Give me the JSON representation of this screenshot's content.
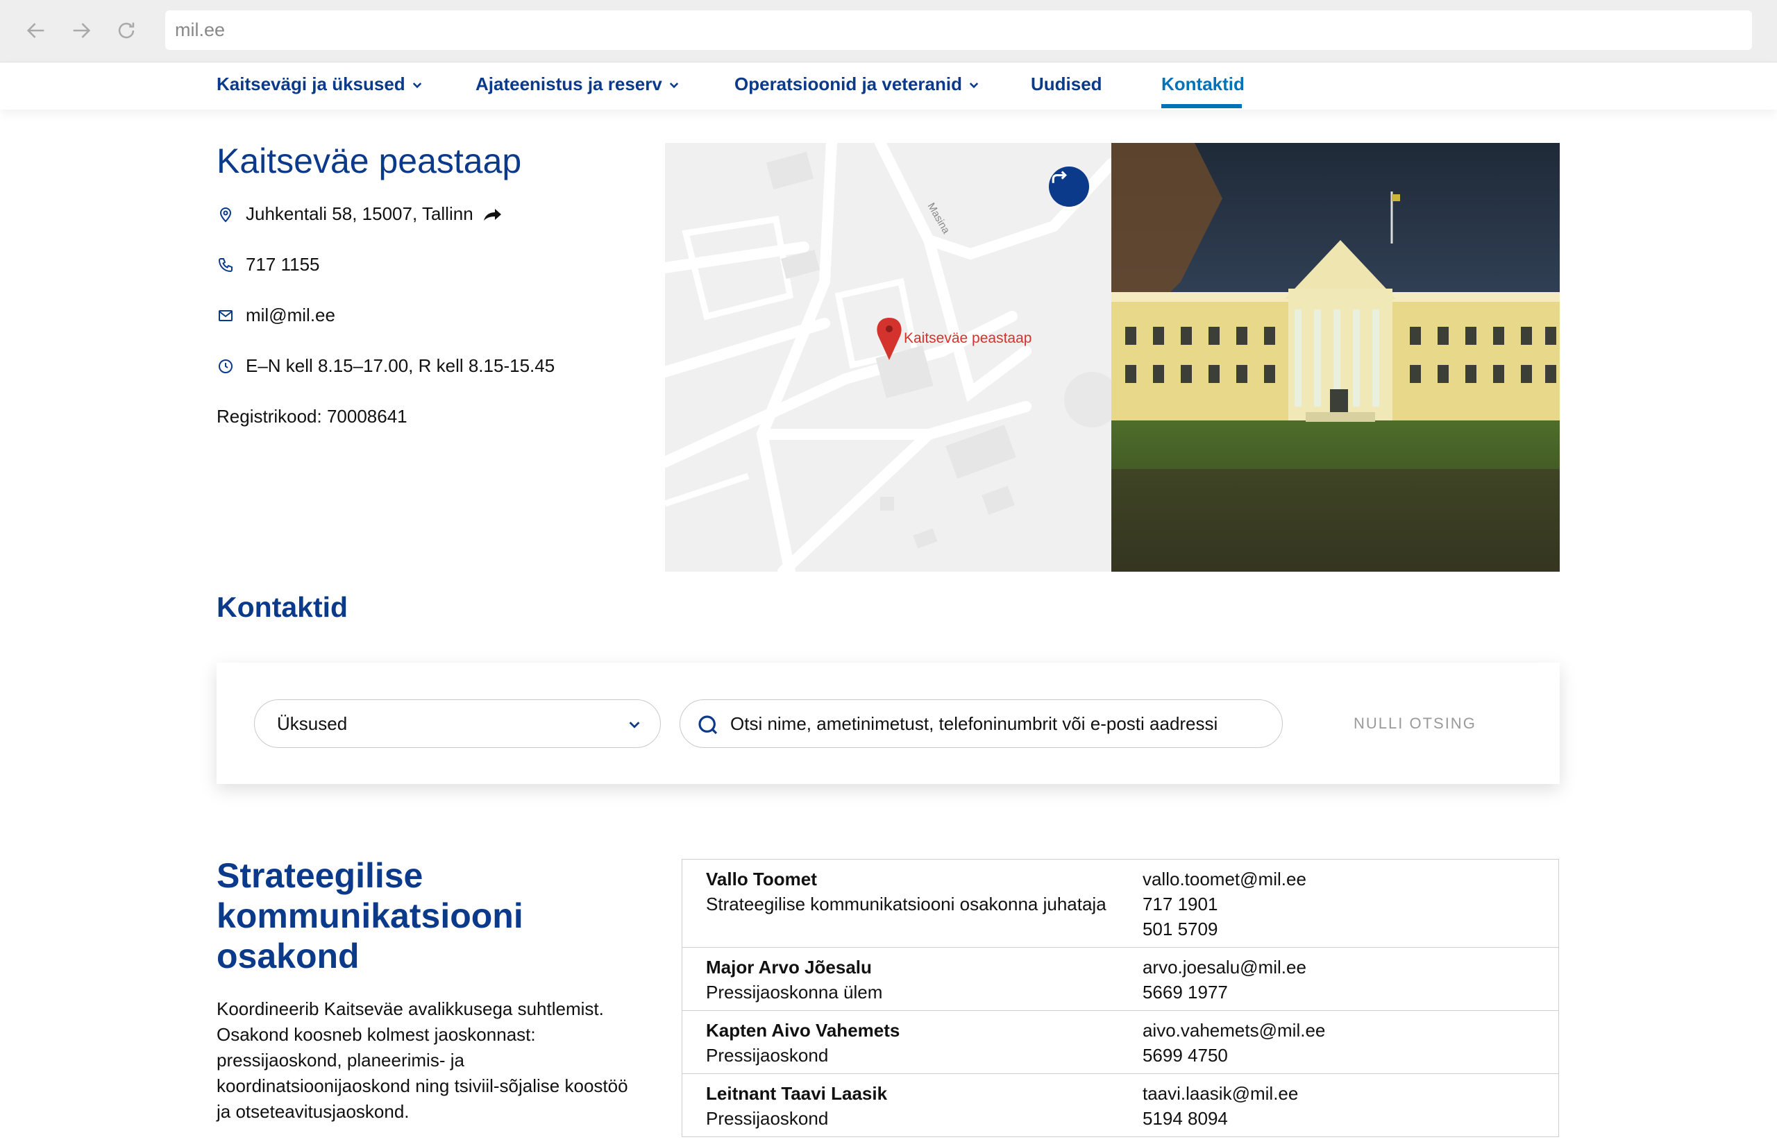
{
  "browser": {
    "url": "mil.ee"
  },
  "nav": {
    "items": [
      {
        "label": "Kaitsevägi ja üksused",
        "dropdown": true
      },
      {
        "label": "Ajateenistus ja reserv",
        "dropdown": true
      },
      {
        "label": "Operatsioonid ja veteranid",
        "dropdown": true
      },
      {
        "label": "Uudised",
        "dropdown": false
      },
      {
        "label": "Kontaktid",
        "dropdown": false,
        "active": true
      }
    ]
  },
  "hq": {
    "title": "Kaitseväe peastaap",
    "address": "Juhkentali 58, 15007, Tallinn",
    "phone": "717 1155",
    "email": "mil@mil.ee",
    "hours": "E–N kell 8.15–17.00, R kell 8.15-15.45",
    "regcode": "Registrikood: 70008641"
  },
  "map": {
    "marker_label": "Kaitseväe peastaap",
    "street_label": "Masina"
  },
  "contacts": {
    "title": "Kontaktid",
    "units_select": "Üksused",
    "search_placeholder": "Otsi nime, ametinimetust, telefoninumbrit või e-posti aadressi",
    "reset_label": "NULLI OTSING"
  },
  "department": {
    "title": "Strateegilise kommunikatsiooni osakond",
    "description": "Koordineerib Kaitseväe avalikkusega suhtlemist. Osakond koosneb kolmest jaoskonnast: pressijaoskond, planeerimis- ja koordinatsioonijaoskond ning tsiviil-sõjalise koostöö ja otseteavitusjaoskond.",
    "people": [
      {
        "name": "Vallo Toomet",
        "role": "Strateegilise kommunikatsiooni osakonna juhataja",
        "email": "vallo.toomet@mil.ee",
        "phone1": "717 1901",
        "phone2": "501 5709"
      },
      {
        "name": "Major Arvo Jõesalu",
        "role": "Pressijaoskonna ülem",
        "email": "arvo.joesalu@mil.ee",
        "phone1": "5669 1977",
        "phone2": ""
      },
      {
        "name": "Kapten Aivo Vahemets",
        "role": "Pressijaoskond",
        "email": "aivo.vahemets@mil.ee",
        "phone1": "5699 4750",
        "phone2": ""
      },
      {
        "name": "Leitnant Taavi Laasik",
        "role": "Pressijaoskond",
        "email": "taavi.laasik@mil.ee",
        "phone1": "5194 8094",
        "phone2": ""
      }
    ]
  },
  "colors": {
    "brand_navy": "#0b3a8a",
    "active_blue": "#0072b8",
    "marker_red": "#d4322c"
  }
}
